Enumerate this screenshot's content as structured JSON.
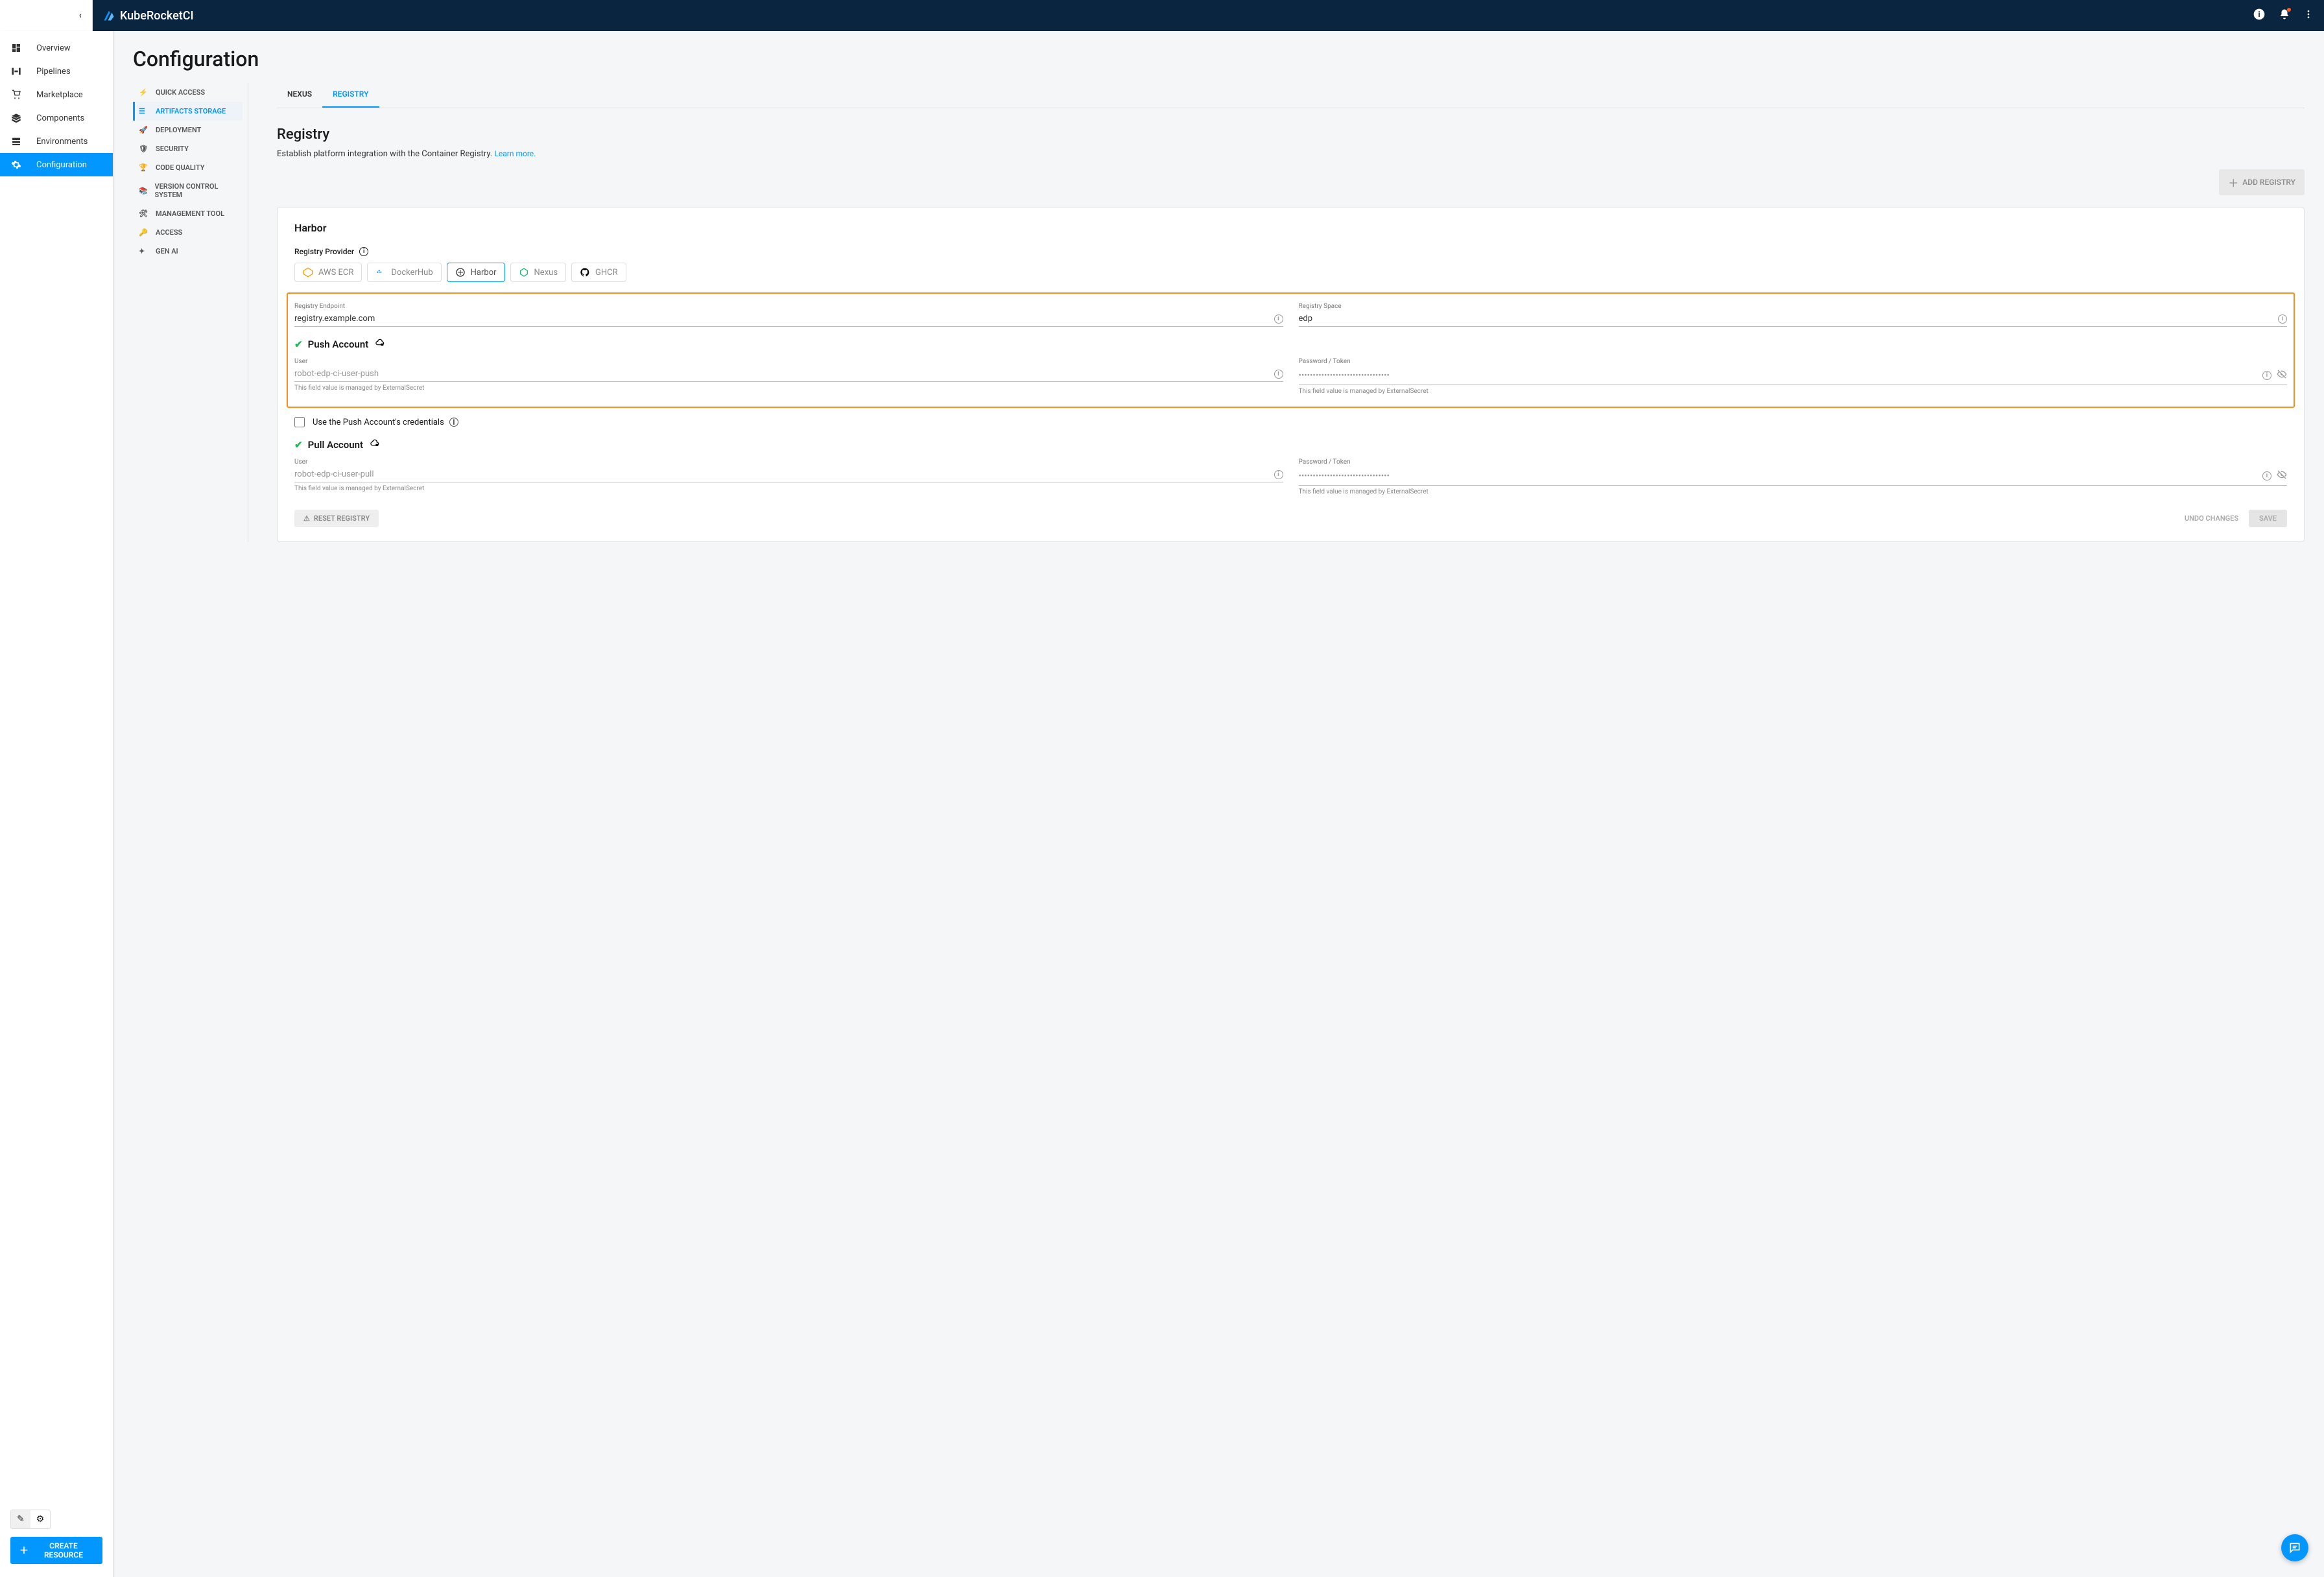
{
  "brand": "KubeRocketCI",
  "sidebar": {
    "items": [
      {
        "label": "Overview",
        "icon": "dashboard-icon"
      },
      {
        "label": "Pipelines",
        "icon": "pipelines-icon"
      },
      {
        "label": "Marketplace",
        "icon": "cart-icon"
      },
      {
        "label": "Components",
        "icon": "layers-icon"
      },
      {
        "label": "Environments",
        "icon": "stack-icon"
      },
      {
        "label": "Configuration",
        "icon": "gear-icon"
      }
    ],
    "create_label": "CREATE RESOURCE"
  },
  "page": {
    "title": "Configuration"
  },
  "config_nav": [
    {
      "label": "QUICK ACCESS"
    },
    {
      "label": "ARTIFACTS STORAGE"
    },
    {
      "label": "DEPLOYMENT"
    },
    {
      "label": "SECURITY"
    },
    {
      "label": "CODE QUALITY"
    },
    {
      "label": "VERSION CONTROL SYSTEM"
    },
    {
      "label": "MANAGEMENT TOOL"
    },
    {
      "label": "ACCESS"
    },
    {
      "label": "GEN AI"
    }
  ],
  "tabs": [
    {
      "label": "NEXUS"
    },
    {
      "label": "REGISTRY"
    }
  ],
  "registry": {
    "title": "Registry",
    "description": "Establish platform integration with the Container Registry.",
    "learn_more": "Learn more.",
    "add_button": "ADD REGISTRY",
    "card_title": "Harbor",
    "provider_label": "Registry Provider",
    "providers": [
      {
        "label": "AWS ECR"
      },
      {
        "label": "DockerHub"
      },
      {
        "label": "Harbor"
      },
      {
        "label": "Nexus"
      },
      {
        "label": "GHCR"
      }
    ],
    "endpoint": {
      "label": "Registry Endpoint",
      "value": "registry.example.com"
    },
    "space": {
      "label": "Registry Space",
      "value": "edp"
    },
    "push_account": {
      "title": "Push Account",
      "user_label": "User",
      "user_value": "robot-edp-ci-user-push",
      "password_label": "Password / Token",
      "password_value": "••••••••••••••••••••••••••••••••",
      "helper": "This field value is managed by ExternalSecret"
    },
    "checkbox_label": "Use the Push Account's credentials",
    "pull_account": {
      "title": "Pull Account",
      "user_label": "User",
      "user_value": "robot-edp-ci-user-pull",
      "password_label": "Password / Token",
      "password_value": "••••••••••••••••••••••••••••••••",
      "helper": "This field value is managed by ExternalSecret"
    },
    "reset_label": "RESET REGISTRY",
    "undo_label": "UNDO CHANGES",
    "save_label": "SAVE"
  }
}
